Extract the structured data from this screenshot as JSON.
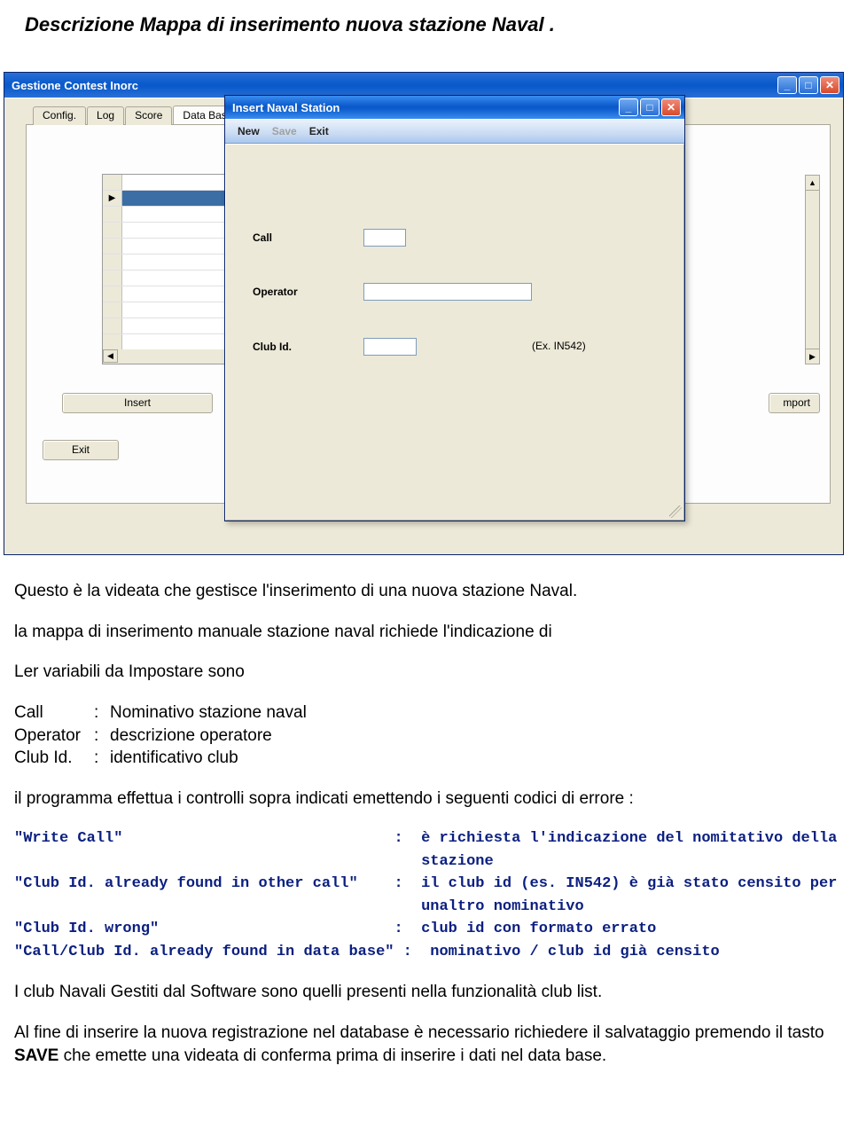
{
  "doc": {
    "title": "Descrizione Mappa di inserimento nuova stazione Naval .",
    "p1": "Questo è la videata che gestisce l'inserimento di una nuova stazione Naval.",
    "p2": "la mappa di inserimento manuale stazione naval richiede l'indicazione di",
    "p3": "Ler variabili da Impostare sono",
    "defs": [
      {
        "k": " Call",
        "c": ":",
        "v": "  Nominativo stazione naval"
      },
      {
        "k": "Operator",
        "c": ":",
        "v": " descrizione operatore"
      },
      {
        "k": "Club Id.",
        "c": ":",
        "v": "  identificativo club"
      }
    ],
    "p4": "il programma effettua i controlli sopra indicati emettendo i seguenti codici di errore :",
    "codes": "\"Write Call\"                              :  è richiesta l'indicazione del nomitativo della\n                                             stazione\n\"Club Id. already found in other call\"    :  il club id (es. IN542) è già stato censito per\n                                             unaltro nominativo\n\"Club Id. wrong\"                          :  club id con formato errato\n\"Call/Club Id. already found in data base\" :  nominativo / club id già censito",
    "p5": "I club Navali Gestiti dal Software sono quelli presenti nella funzionalità club list.",
    "p6a": "Al fine di inserire la nuova registrazione nel database è necessario richiedere il salvataggio premendo il tasto ",
    "p6b": "SAVE",
    "p6c": " che emette una videata di conferma prima di inserire i dati nel data base."
  },
  "outer": {
    "title": "Gestione Contest Inorc",
    "tabs": [
      "Config.",
      "Log",
      "Score",
      "Data Bas"
    ],
    "insert": "Insert",
    "exit": "Exit",
    "mport": "mport"
  },
  "dialog": {
    "title": "Insert Naval Station",
    "menu": {
      "new": "New",
      "save": "Save",
      "exit": "Exit"
    },
    "labels": {
      "call": "Call",
      "operator": "Operator",
      "club": "Club Id."
    },
    "hint": "(Ex. IN542)"
  }
}
